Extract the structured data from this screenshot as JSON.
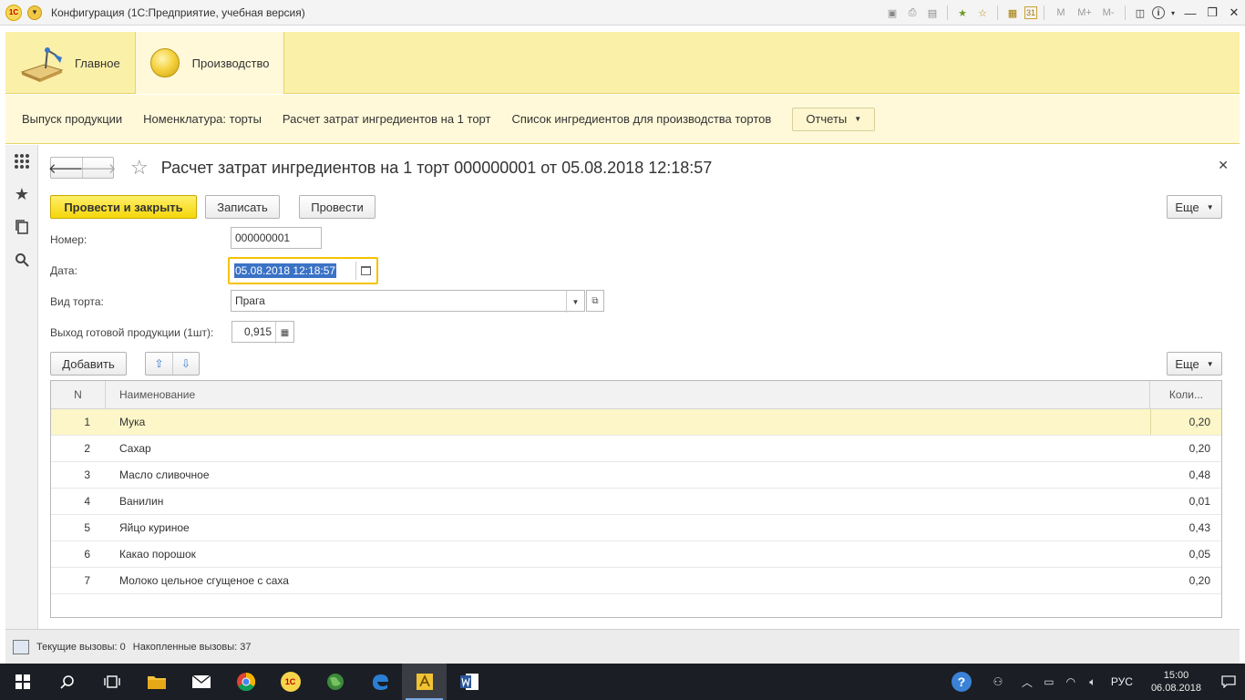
{
  "window": {
    "title": "Конфигурация  (1С:Предприятие, учебная версия)",
    "logo_text": "1С"
  },
  "title_tools": {
    "m": "M",
    "m_plus": "M+",
    "m_minus": "M-",
    "calendar_day": "31",
    "info": "i"
  },
  "sections": [
    {
      "label": "Главное"
    },
    {
      "label": "Производство"
    }
  ],
  "nav": {
    "links": [
      "Выпуск продукции",
      "Номенклатура: торты",
      "Расчет затрат ингредиентов на 1 торт",
      "Список ингредиентов для производства тортов"
    ],
    "reports": "Отчеты"
  },
  "form": {
    "title": "Расчет затрат ингредиентов на 1 торт 000000001 от 05.08.2018 12:18:57",
    "buttons": {
      "post_close": "Провести и закрыть",
      "save": "Записать",
      "post": "Провести",
      "more": "Еще",
      "add": "Добавить",
      "more2": "Еще"
    },
    "fields": {
      "number_label": "Номер:",
      "number_value": "000000001",
      "date_label": "Дата:",
      "date_value": "05.08.2018 12:18:57",
      "cake_label": "Вид торта:",
      "cake_value": "Прага",
      "output_label": "Выход готовой продукции (1шт):",
      "output_value": "0,915"
    },
    "table": {
      "headers": {
        "n": "N",
        "name": "Наименование",
        "qty": "Коли..."
      },
      "rows": [
        {
          "n": "1",
          "name": "Мука",
          "qty": "0,20"
        },
        {
          "n": "2",
          "name": "Сахар",
          "qty": "0,20"
        },
        {
          "n": "3",
          "name": "Масло сливочное",
          "qty": "0,48"
        },
        {
          "n": "4",
          "name": "Ванилин",
          "qty": "0,01"
        },
        {
          "n": "5",
          "name": "Яйцо куриное",
          "qty": "0,43"
        },
        {
          "n": "6",
          "name": "Какао порошок",
          "qty": "0,05"
        },
        {
          "n": "7",
          "name": "Молоко цельное сгущеное с саха",
          "qty": "0,20"
        }
      ]
    }
  },
  "statusbar": {
    "current_calls": "Текущие вызовы: 0",
    "accumulated_calls": "Накопленные вызовы: 37"
  },
  "taskbar": {
    "lang": "РУС",
    "time": "15:00",
    "date": "06.08.2018",
    "app_1c": "1С"
  }
}
